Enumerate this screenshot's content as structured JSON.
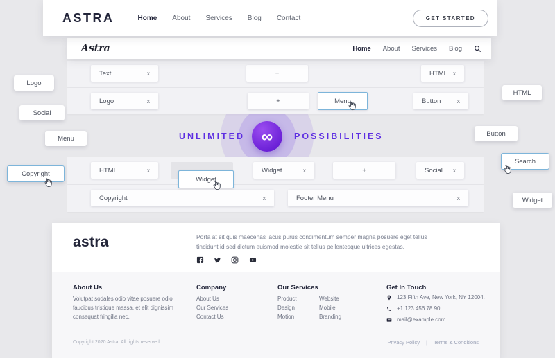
{
  "ui": {
    "remove_glyph": "x",
    "add_glyph": "+"
  },
  "colors": {
    "accent_purple": "#5d2ee2",
    "highlight_border": "#7db5da",
    "dark_text": "#23253a",
    "background": "#e8e8eb"
  },
  "icons": {
    "search": "magnifier",
    "cursor": "hand-pointer",
    "social": [
      "facebook",
      "twitter",
      "instagram",
      "youtube"
    ],
    "contact": [
      "location-pin",
      "phone",
      "envelope"
    ]
  },
  "top_nav": {
    "logo": "ASTRA",
    "items": [
      "Home",
      "About",
      "Services",
      "Blog",
      "Contact"
    ],
    "cta": "GET STARTED"
  },
  "site_header": {
    "logo": "Astra",
    "items": [
      "Home",
      "About",
      "Services",
      "Blog"
    ]
  },
  "hero": {
    "left": "UNLIMITED",
    "right": "POSSIBILITIES",
    "symbol": "∞"
  },
  "builder": {
    "header_row_1": {
      "left": "Text",
      "center": "+",
      "right": "HTML"
    },
    "header_row_2": {
      "left": "Logo",
      "center": "+",
      "drag": "Menu",
      "right": "Button"
    },
    "footer_row_1": {
      "c1": "HTML",
      "c2": "Widget",
      "c3": "+",
      "c4": "Social",
      "drag": "Widget"
    },
    "footer_row_2": {
      "c1": "Copyright",
      "c2": "Footer Menu"
    }
  },
  "floating_labels": {
    "left": [
      "Logo",
      "Social",
      "Menu",
      "Copyright"
    ],
    "right": [
      "HTML",
      "Button",
      "Search",
      "Widget"
    ]
  },
  "footer": {
    "logo": "astra",
    "description": "Porta at sit quis maecenas lacus purus condimentum semper magna posuere eget tellus tincidunt id sed dictum euismod molestie sit tellus pellentesque ultrices egestas.",
    "columns": {
      "about": {
        "title": "About Us",
        "text": "Volutpat sodales odio vitae posuere odio faucibus tristique massa, et elit dignissim consequat fringilla nec."
      },
      "company": {
        "title": "Company",
        "links": [
          "About Us",
          "Our Services",
          "Contact Us"
        ]
      },
      "services": {
        "title": "Our Services",
        "col1": [
          "Product",
          "Design",
          "Motion"
        ],
        "col2": [
          "Website",
          "Mobile",
          "Branding"
        ]
      },
      "contact": {
        "title": "Get In Touch",
        "address": "123 Fifth Ave, New York, NY 12004.",
        "phone": "+1 123 456 78 90",
        "email": "mail@example.com"
      }
    },
    "bottom": {
      "copyright": "Copyright 2020 Astra. All rights reserved.",
      "privacy": "Privacy Policy",
      "separator": "|",
      "terms": "Terms & Conditions"
    }
  }
}
